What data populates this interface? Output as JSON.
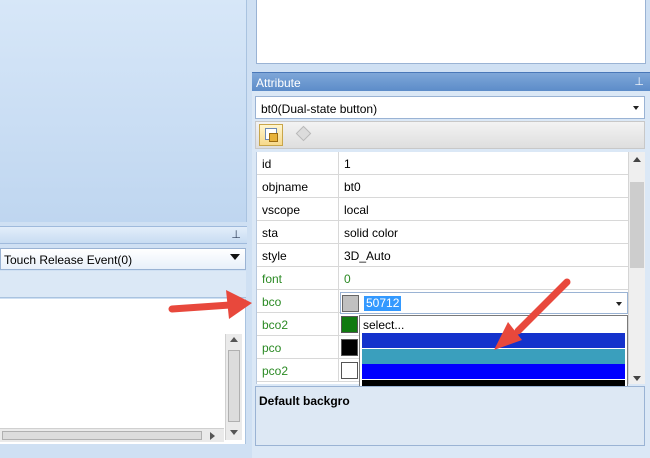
{
  "left_panel": {
    "event_select_value": "Touch Release Event(0)"
  },
  "attribute_panel": {
    "title": "Attribute",
    "pin_glyph": "⊥",
    "object_select_value": "bt0(Dual-state button)",
    "properties": [
      {
        "name": "id",
        "value": "1",
        "green": false
      },
      {
        "name": "objname",
        "value": "bt0",
        "green": false
      },
      {
        "name": "vscope",
        "value": "local",
        "green": false
      },
      {
        "name": "sta",
        "value": "solid color",
        "green": false
      },
      {
        "name": "style",
        "value": "3D_Auto",
        "green": false
      },
      {
        "name": "font",
        "value": "0",
        "green": true
      },
      {
        "name": "bco",
        "value": "50712",
        "green": true,
        "swatch": "#c0c0c0"
      },
      {
        "name": "bco2",
        "value": "",
        "green": true,
        "swatch": "#107a10"
      },
      {
        "name": "pco",
        "value": "",
        "green": true,
        "swatch": "#000000"
      },
      {
        "name": "pco2",
        "value": "",
        "green": true,
        "swatch": "#ffffff"
      }
    ],
    "color_dropdown": {
      "first_option": "select...",
      "colors": [
        "#1432cc",
        "#3a9fbd",
        "#0000ff",
        "#000000",
        "#ffff00"
      ]
    },
    "description": "Default backgro"
  },
  "annotations": {
    "arrow_color": "#e8483c"
  }
}
